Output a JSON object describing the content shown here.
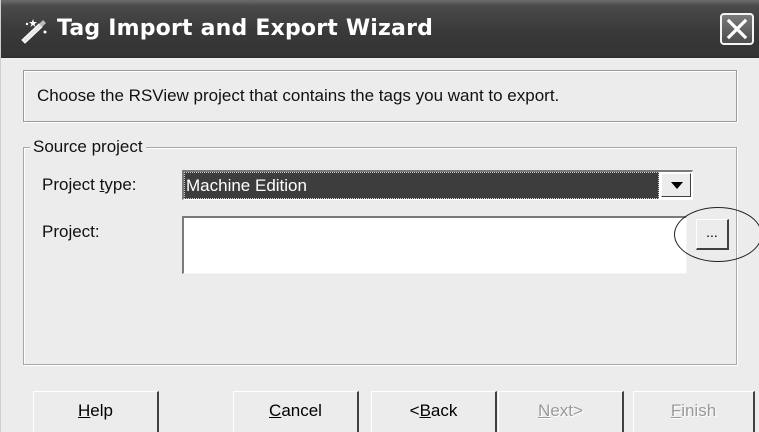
{
  "window": {
    "title": "Tag Import and Export Wizard",
    "app_icon": "wand-pencil-icon",
    "close_icon": "close-icon"
  },
  "instruction": "Choose the RSView project that contains the tags you want to export.",
  "source_group": {
    "legend": "Source project",
    "project_type": {
      "label_before": "Project ",
      "label_mnemonic": "t",
      "label_after": "ype:",
      "selected_value": "Machine Edition",
      "dropdown_icon": "chevron-down-icon"
    },
    "project": {
      "label": "Project:",
      "value": "",
      "browse_label": "..."
    }
  },
  "buttons": {
    "help": {
      "mnemonic": "H",
      "rest": "elp"
    },
    "cancel": {
      "mnemonic": "C",
      "rest": "ancel"
    },
    "back": {
      "prefix": "<",
      "mnemonic": "B",
      "rest": "ack"
    },
    "next": {
      "mnemonic": "N",
      "rest": "ext>"
    },
    "finish": {
      "mnemonic": "F",
      "rest": "inish"
    }
  },
  "colors": {
    "title_bar": "#3a3a3a",
    "dialog_face": "#ececec",
    "selection": "#3d3d3d",
    "disabled_text": "#9a9a9a"
  }
}
